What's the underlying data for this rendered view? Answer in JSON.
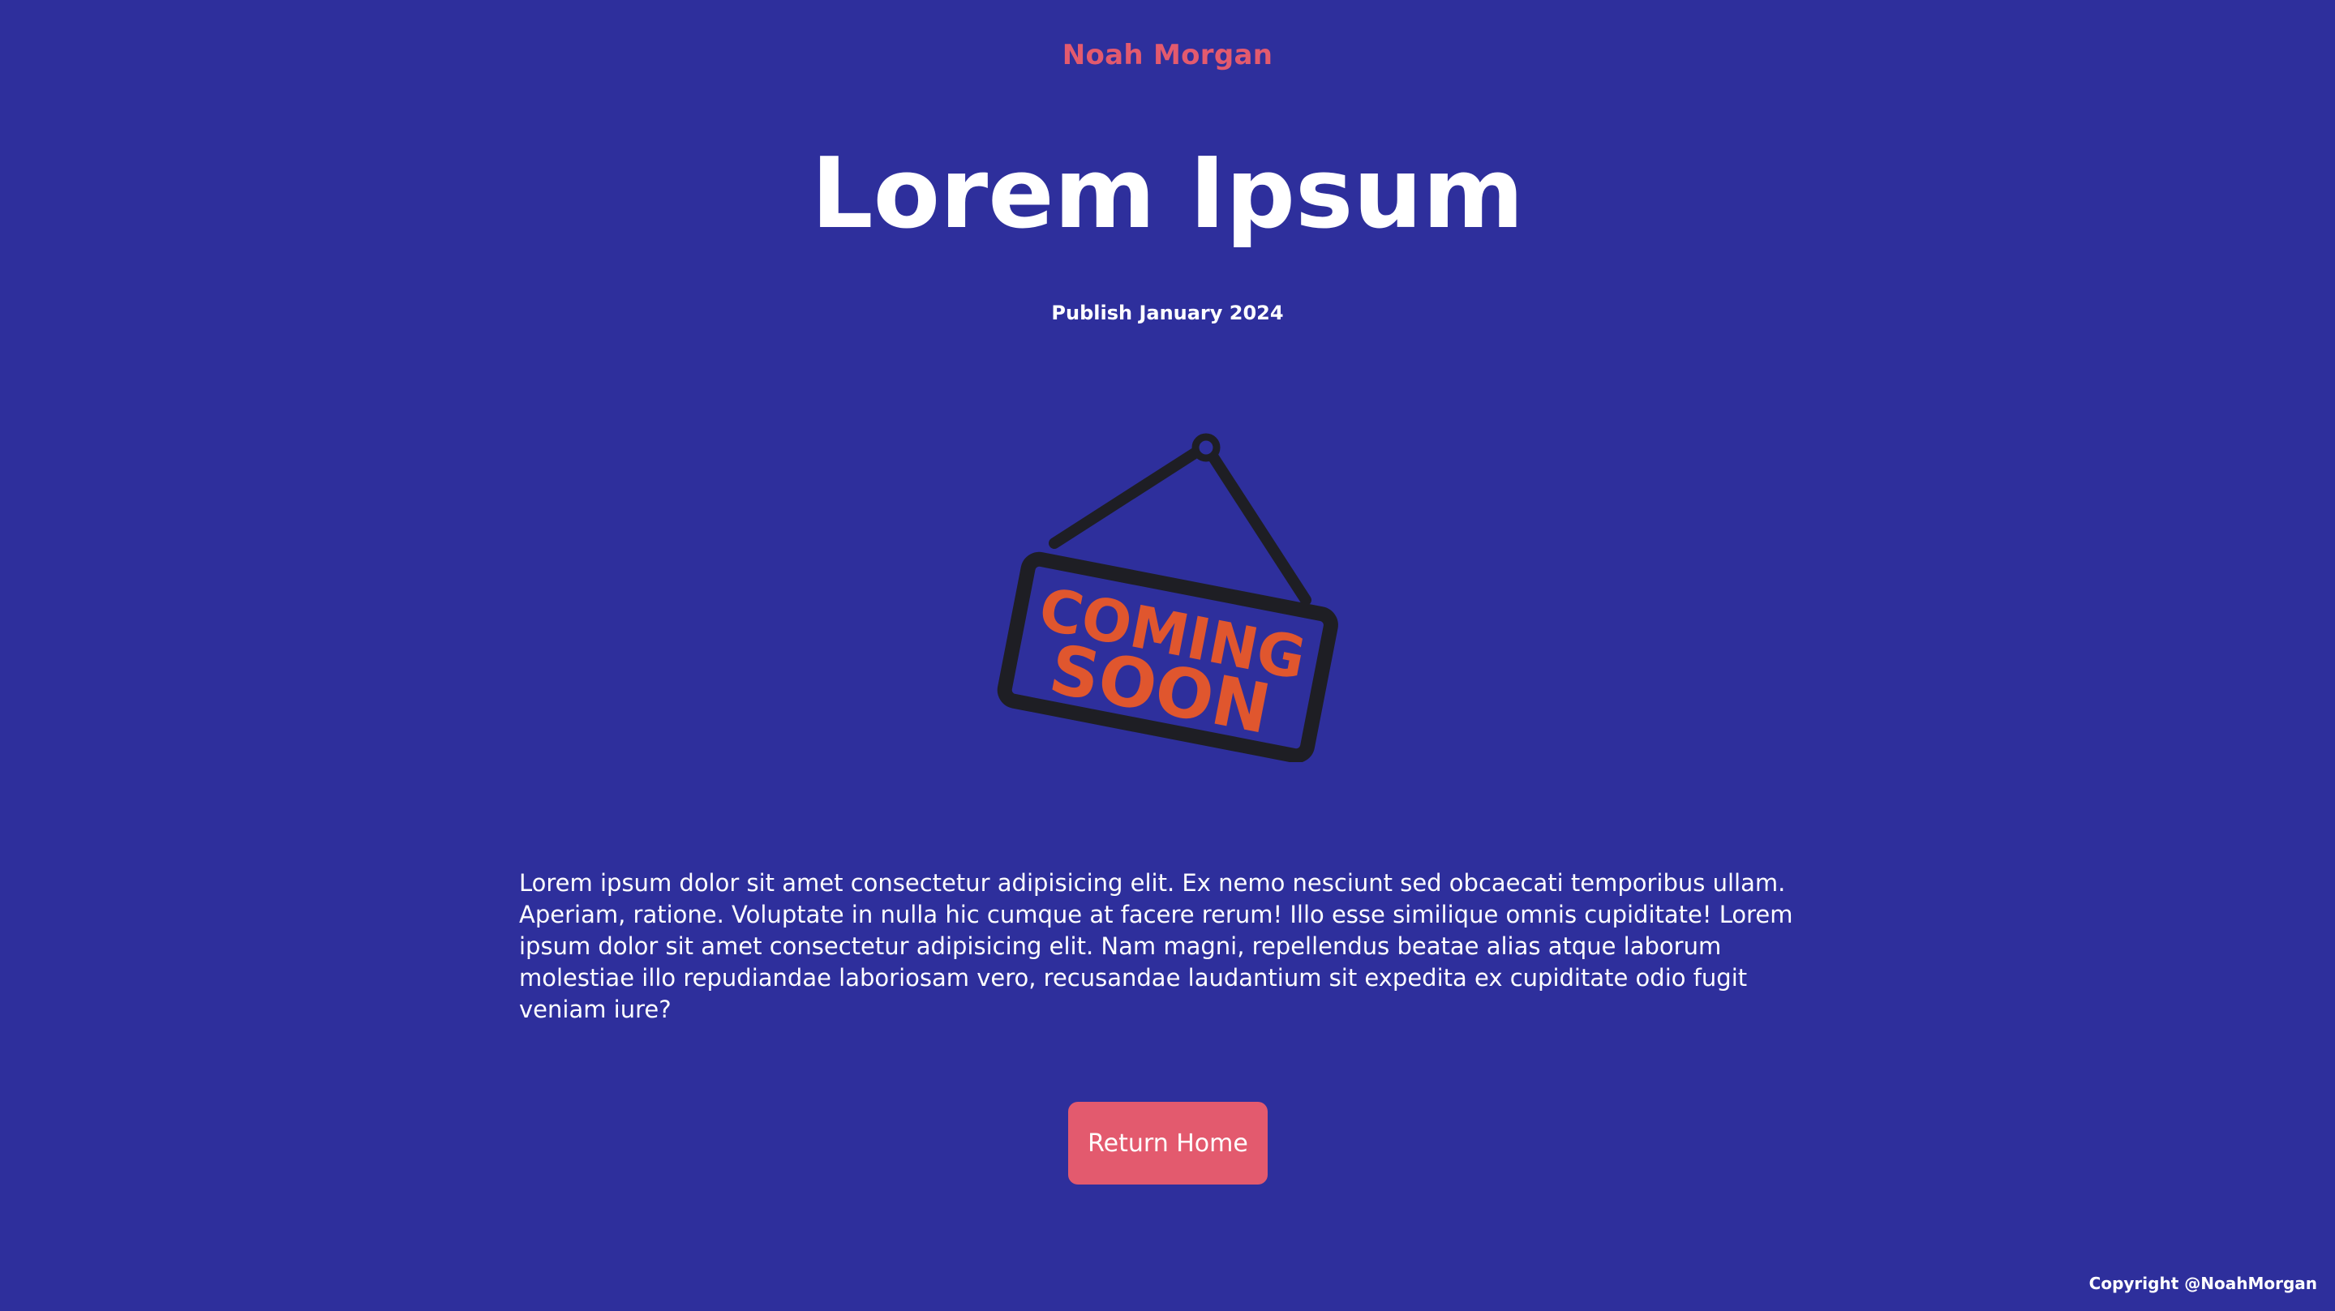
{
  "header": {
    "brand": "Noah Morgan"
  },
  "main": {
    "title": "Lorem Ipsum",
    "publish_date": "Publish January 2024",
    "illustration": {
      "icon": "coming-soon-sign-icon",
      "line1": "COMING",
      "line2": "SOON"
    },
    "body_text": "Lorem ipsum dolor sit amet consectetur adipisicing elit. Ex nemo nesciunt sed obcaecati temporibus ullam. Aperiam, ratione. Voluptate in nulla hic cumque at facere rerum! Illo esse similique omnis cupiditate! Lorem ipsum dolor sit amet consectetur adipisicing elit. Nam magni, repellendus beatae alias atque laborum molestiae illo repudiandae laboriosam vero, recusandae laudantium sit expedita ex cupiditate odio fugit veniam iure?",
    "return_button": "Return Home"
  },
  "footer": {
    "copyright": "Copyright @NoahMorgan"
  },
  "colors": {
    "background": "#2E2F9C",
    "accent": "#E35A6E",
    "sign_text": "#E0562E",
    "sign_frame": "#1E1E24"
  }
}
